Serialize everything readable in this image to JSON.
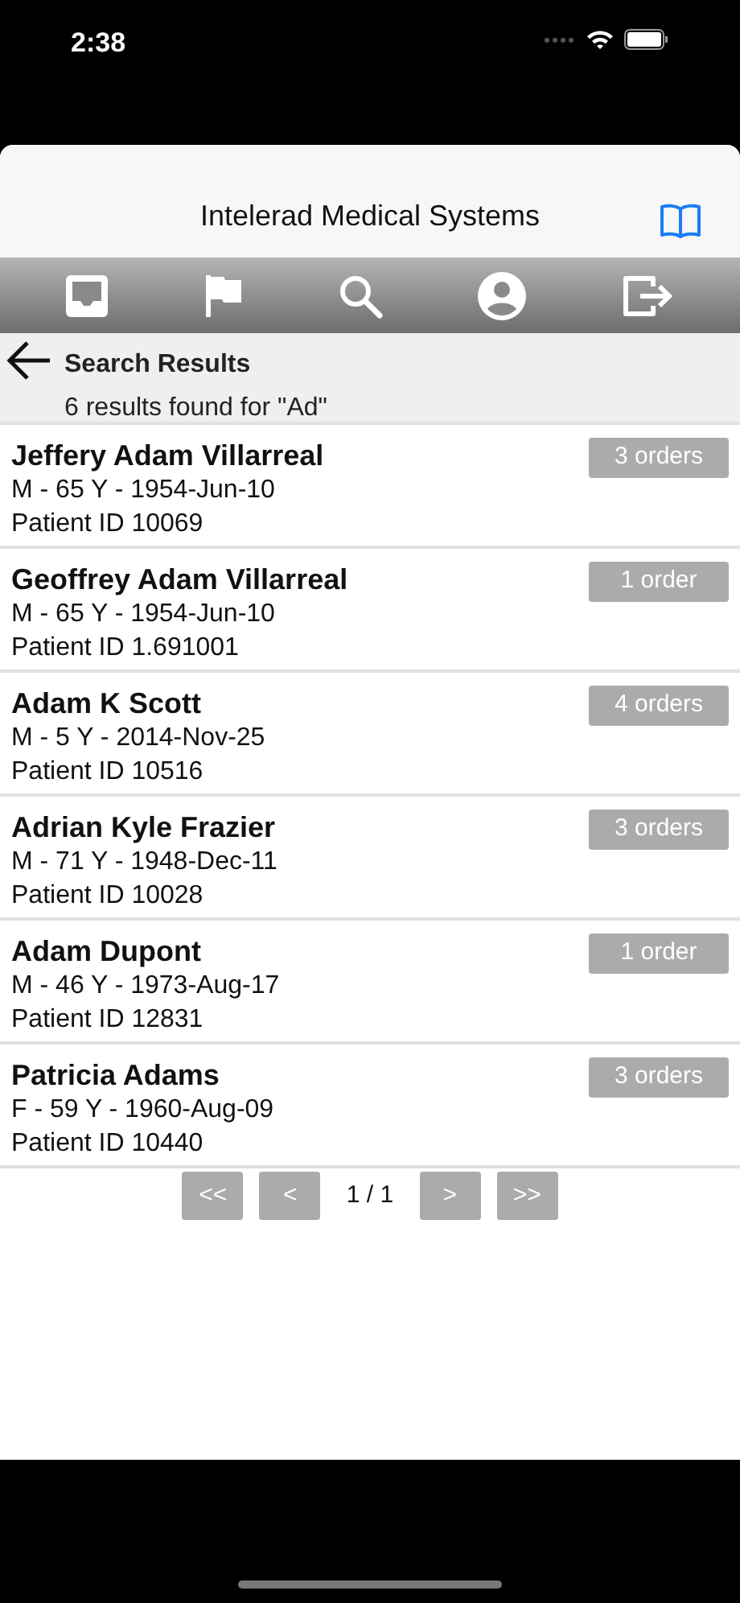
{
  "status_bar": {
    "time": "2:38"
  },
  "header": {
    "title": "Intelerad Medical Systems"
  },
  "search_header": {
    "title": "Search Results",
    "subtitle": "6 results found for \"Ad\""
  },
  "patients": [
    {
      "name": "Jeffery Adam Villarreal",
      "details": "M - 65 Y - 1954-Jun-10",
      "patient_id": "Patient ID 10069",
      "orders": "3 orders"
    },
    {
      "name": "Geoffrey Adam Villarreal",
      "details": "M - 65 Y - 1954-Jun-10",
      "patient_id": "Patient ID 1.691001",
      "orders": "1 order"
    },
    {
      "name": "Adam K Scott",
      "details": "M - 5 Y - 2014-Nov-25",
      "patient_id": "Patient ID 10516",
      "orders": "4 orders"
    },
    {
      "name": "Adrian Kyle Frazier",
      "details": "M - 71 Y - 1948-Dec-11",
      "patient_id": "Patient ID 10028",
      "orders": "3 orders"
    },
    {
      "name": "Adam Dupont",
      "details": "M - 46 Y - 1973-Aug-17",
      "patient_id": "Patient ID 12831",
      "orders": "1 order"
    },
    {
      "name": "Patricia Adams",
      "details": "F - 59 Y - 1960-Aug-09",
      "patient_id": "Patient ID 10440",
      "orders": "3 orders"
    }
  ],
  "pagination": {
    "first": "<<",
    "prev": "<",
    "page": "1 / 1",
    "next": ">",
    "last": ">>"
  }
}
